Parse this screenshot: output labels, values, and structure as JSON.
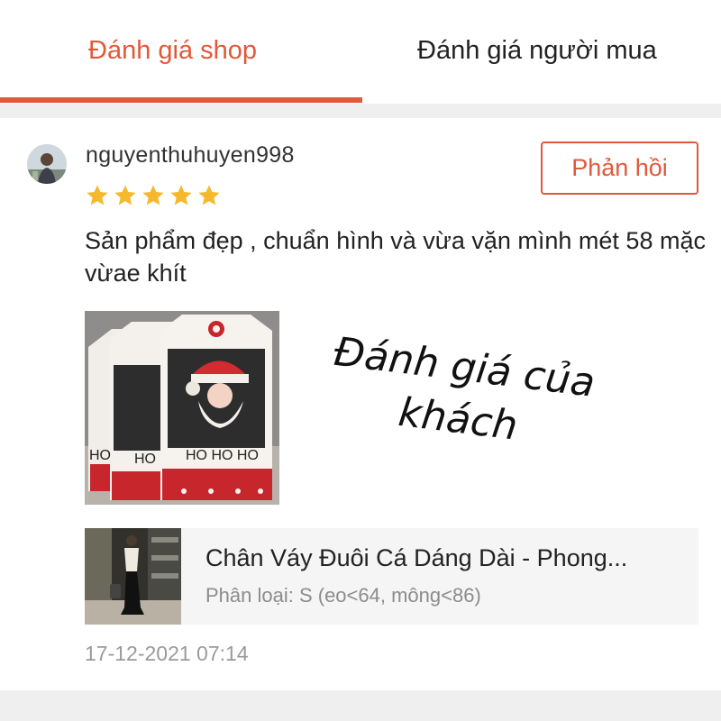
{
  "tabs": [
    {
      "label": "Đánh giá shop",
      "active": true
    },
    {
      "label": "Đánh giá người mua",
      "active": false
    }
  ],
  "accent_color": "#e0593a",
  "review": {
    "username": "nguyenthuhuyen998",
    "rating": 5,
    "rating_max": 5,
    "reply_label": "Phản hồi",
    "text": "Sản phẩm đẹp , chuẩn hình và vừa vặn mình mét 58 mặc vừae khít",
    "image_overlay_text": "Đánh giá của khách",
    "image_card_labels": [
      "HO",
      "HO",
      "HO HO HO"
    ],
    "product": {
      "name": "Chân Váy Đuôi Cá Dáng Dài - Phong...",
      "variant": "Phân loại: S (eo<64, mông<86)"
    },
    "timestamp": "17-12-2021 07:14"
  },
  "icons": {
    "avatar": "user-avatar",
    "star": "star-icon"
  }
}
